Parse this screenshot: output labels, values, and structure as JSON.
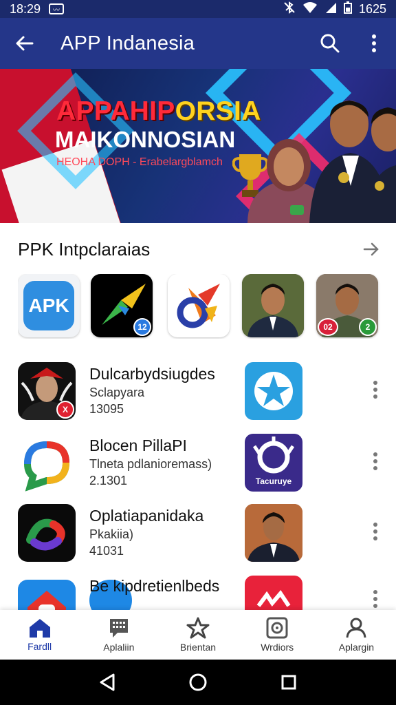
{
  "status_bar": {
    "time": "18:29",
    "battery": "1625"
  },
  "app_bar": {
    "title": "APP Indanesia"
  },
  "banner": {
    "headline_a": "APPAHIP",
    "headline_b": "ORSIA",
    "line2": "MAIKONNOSIAN",
    "line3": "HEOHA DOPH  -  Erabelargblamch"
  },
  "section": {
    "title": "PPK Intpclaraias"
  },
  "featured_icons": [
    {
      "name": "apk",
      "label": "APK",
      "badge": ""
    },
    {
      "name": "arrow-app",
      "label": "",
      "badge": "12"
    },
    {
      "name": "swirl-app",
      "label": "",
      "badge": ""
    },
    {
      "name": "official-app",
      "label": "",
      "badge": ""
    },
    {
      "name": "portrait-app",
      "label": "",
      "badge_left": "02",
      "badge": "2"
    }
  ],
  "list": [
    {
      "name": "Dulcarbydsiugdes",
      "sub": "Sclapyara",
      "num": "13095",
      "badge": "X",
      "icon2_label": ""
    },
    {
      "name": "Blocen PillaPI",
      "sub": "Tlneta pdlanioremass)",
      "num": "2.1301",
      "icon2_label": "Tacuruye"
    },
    {
      "name": "Oplatiapanidaka",
      "sub": "Pkakiia)",
      "num": "41031",
      "icon2_label": ""
    },
    {
      "name": "Be kipdretienlbeds",
      "sub": "",
      "num": "",
      "icon2_label": ""
    }
  ],
  "bottom_nav": [
    {
      "label": "Fardll",
      "icon": "home-icon"
    },
    {
      "label": "Aplaliin",
      "icon": "chat-grid-icon"
    },
    {
      "label": "Brientan",
      "icon": "star-icon"
    },
    {
      "label": "Wrdiors",
      "icon": "settings-icon"
    },
    {
      "label": "Aplargin",
      "icon": "person-icon"
    }
  ],
  "colors": {
    "app_bar": "#243689",
    "status_bar": "#1b2a6b",
    "active_nav": "#1e3aa8"
  }
}
